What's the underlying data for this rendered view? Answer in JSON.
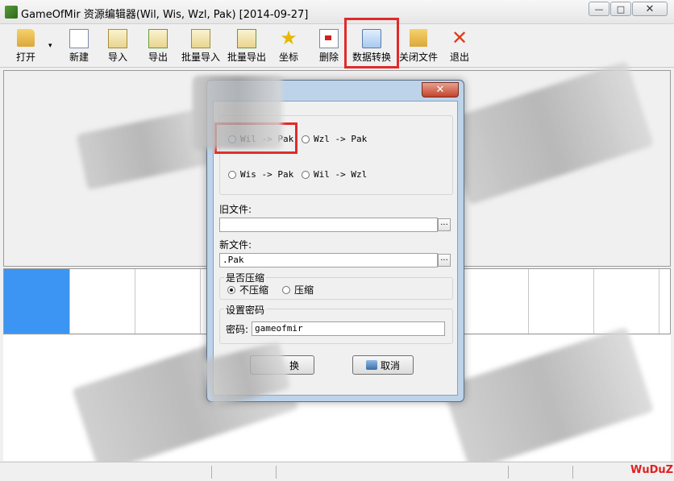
{
  "window": {
    "title": "GameOfMir 资源编辑器(Wil, Wis, Wzl, Pak) [2014-09-27]",
    "controls": {
      "minimize": "—",
      "maximize": "□",
      "close": "✕"
    }
  },
  "toolbar": {
    "items": [
      {
        "label": "打开",
        "icon": "folder-open-icon"
      },
      {
        "label": "新建",
        "icon": "new-file-icon"
      },
      {
        "label": "导入",
        "icon": "import-icon"
      },
      {
        "label": "导出",
        "icon": "export-icon"
      },
      {
        "label": "批量导入",
        "icon": "batch-import-icon"
      },
      {
        "label": "批量导出",
        "icon": "batch-export-icon"
      },
      {
        "label": "坐标",
        "icon": "star-icon"
      },
      {
        "label": "删除",
        "icon": "delete-icon"
      },
      {
        "label": "数据转换",
        "icon": "data-convert-icon"
      },
      {
        "label": "关闭文件",
        "icon": "close-file-icon"
      },
      {
        "label": "退出",
        "icon": "exit-icon"
      }
    ],
    "dropdown_arrow": "▾"
  },
  "dialog": {
    "close": "✕",
    "conversion": {
      "options": [
        {
          "label": "Wil -> Pak",
          "selected": false
        },
        {
          "label": "Wzl -> Pak",
          "selected": false
        },
        {
          "label": "Wis -> Pak",
          "selected": false
        },
        {
          "label": "Wil -> Wzl",
          "selected": false
        }
      ]
    },
    "old_file": {
      "label": "旧文件:",
      "value": "",
      "browse": "..."
    },
    "new_file": {
      "label": "新文件:",
      "value": ".Pak",
      "browse": "..."
    },
    "compress": {
      "title": "是否压缩",
      "options": [
        {
          "label": "不压缩",
          "selected": true
        },
        {
          "label": "压缩",
          "selected": false
        }
      ]
    },
    "password": {
      "title": "设置密码",
      "label": "密码:",
      "value": "gameofmir"
    },
    "buttons": {
      "convert": "换",
      "cancel": "取消"
    }
  },
  "watermark": "WuDuZ",
  "colors": {
    "selection": "#3c95f2",
    "highlight": "#e02a2a"
  }
}
